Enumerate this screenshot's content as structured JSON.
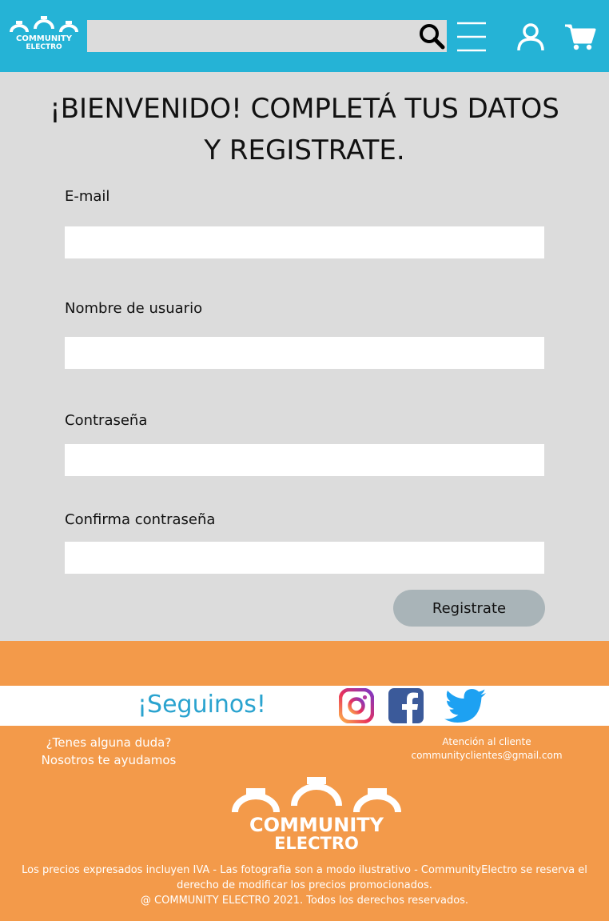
{
  "header": {
    "logo_line1": "COMMUNITY",
    "logo_line2": "ELECTRO",
    "search_value": "",
    "search_placeholder": "",
    "icons": [
      "search-icon",
      "menu-icon",
      "user-icon",
      "cart-icon"
    ],
    "color": "#25b3d6"
  },
  "form": {
    "title_line1": "¡BIENVENIDO! COMPLETÁ TUS DATOS",
    "title_line2": "Y REGISTRATE.",
    "email_label": "E-mail",
    "username_label": "Nombre de usuario",
    "password_label": "Contraseña",
    "confirm_label": "Confirma contraseña",
    "email_value": "",
    "username_value": "",
    "password_value": "",
    "confirm_value": "",
    "submit_label": "Registrate",
    "background": "#dcdcdc"
  },
  "footer": {
    "follow_label": "¡Seguinos!",
    "social_icons": [
      "instagram-icon",
      "facebook-icon",
      "twitter-icon"
    ],
    "help_line1": "¿Tenes alguna duda?",
    "help_line2": "Nosotros te ayudamos",
    "contact_title": "Atención al cliente",
    "contact_email": "communityclientes@gmail.com",
    "logo_line1": "COMMUNITY",
    "logo_line2": "ELECTRO",
    "legal_line1": "Los precios expresados incluyen IVA - Las fotografia son a modo ilustrativo - CommunityElectro se reserva el derecho de modificar los precios promocionados.",
    "legal_line2": "@ COMMUNITY ELECTRO 2021. Todos los derechos reservados.",
    "color": "#f39a4a"
  }
}
